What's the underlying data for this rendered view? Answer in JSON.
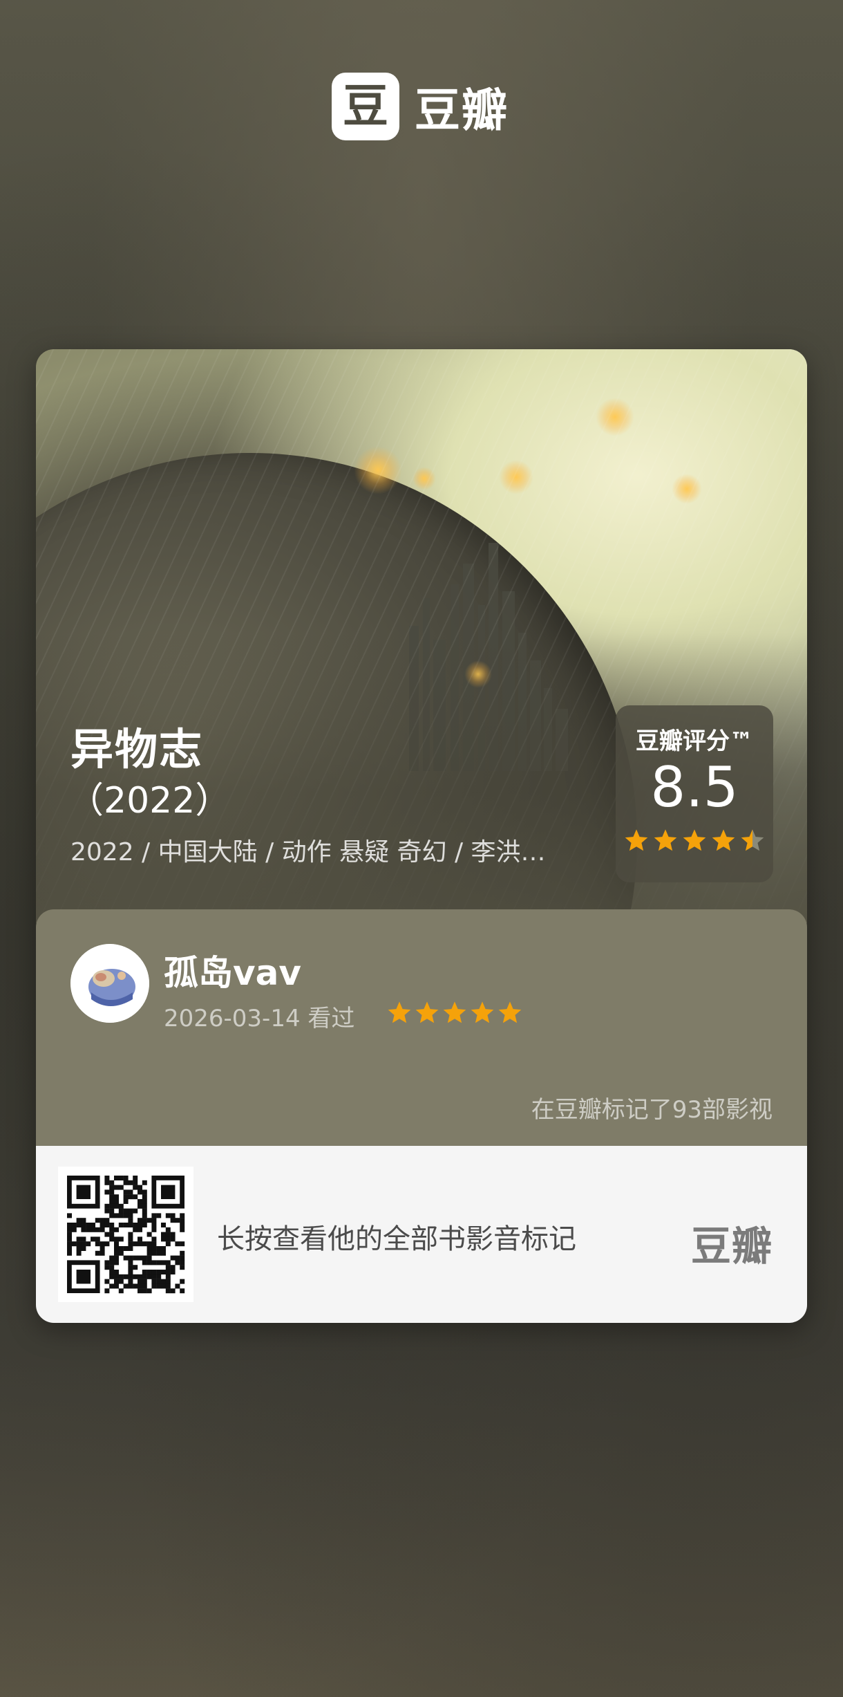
{
  "app": {
    "logo_mark": "豆",
    "logo_text": "豆瓣"
  },
  "movie": {
    "title": "异物志",
    "year": "（2022）",
    "meta": "2022 / 中国大陆 / 动作 悬疑 奇幻 / 李洪…",
    "rating_label": "豆瓣评分™",
    "rating_score": "8.5",
    "rating_stars": 4.5
  },
  "review": {
    "username": "孤岛vav",
    "date_status": "2026-03-14 看过",
    "user_stars": 5,
    "mark_count_text": "在豆瓣标记了93部影视"
  },
  "footer": {
    "prompt": "长按查看他的全部书影音标记",
    "brand": "豆瓣"
  },
  "colors": {
    "star": "#f5a20a",
    "star_empty": "#8a8a7a",
    "review_bg": "#7f7c68",
    "footer_bg": "#f5f5f5"
  }
}
